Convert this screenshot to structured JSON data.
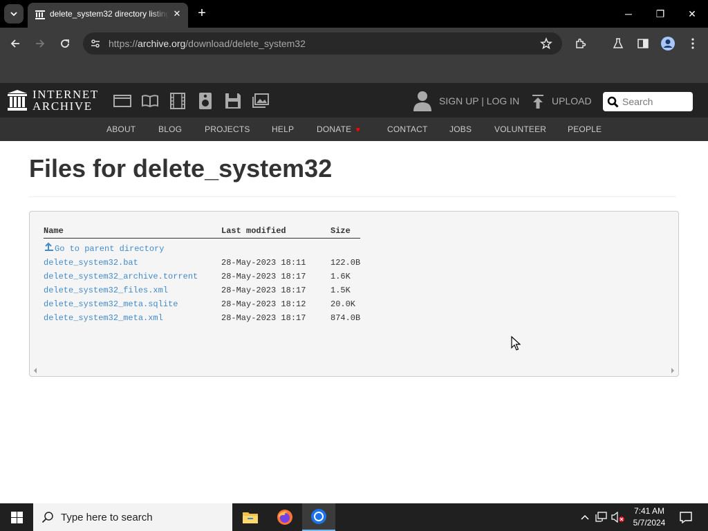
{
  "browser": {
    "tab_title": "delete_system32 directory listing",
    "url_scheme": "https://",
    "url_host": "archive.org",
    "url_path": "/download/delete_system32",
    "window_controls": {
      "minimize": "─",
      "restore": "❐",
      "close": "✕"
    }
  },
  "ia": {
    "logo_line1": "INTERNET",
    "logo_line2": "ARCHIVE",
    "media_icons": [
      "web-icon",
      "texts-icon",
      "video-icon",
      "audio-icon",
      "software-icon",
      "images-icon"
    ],
    "signup": "SIGN UP | LOG IN",
    "upload": "UPLOAD",
    "search_placeholder": "Search",
    "nav": [
      "ABOUT",
      "BLOG",
      "PROJECTS",
      "HELP",
      "DONATE",
      "CONTACT",
      "JOBS",
      "VOLUNTEER",
      "PEOPLE"
    ]
  },
  "page": {
    "title": "Files for delete_system32",
    "columns": [
      "Name",
      "Last modified",
      "Size"
    ],
    "parent_link": "Go to parent directory",
    "files": [
      {
        "name": "delete_system32.bat",
        "modified": "28-May-2023 18:11",
        "size": "122.0B"
      },
      {
        "name": "delete_system32_archive.torrent",
        "modified": "28-May-2023 18:17",
        "size": "1.6K"
      },
      {
        "name": "delete_system32_files.xml",
        "modified": "28-May-2023 18:17",
        "size": "1.5K"
      },
      {
        "name": "delete_system32_meta.sqlite",
        "modified": "28-May-2023 18:12",
        "size": "20.0K"
      },
      {
        "name": "delete_system32_meta.xml",
        "modified": "28-May-2023 18:17",
        "size": "874.0B"
      }
    ]
  },
  "taskbar": {
    "search_placeholder": "Type here to search",
    "time": "7:41 AM",
    "date": "5/7/2024"
  },
  "colors": {
    "link": "#428bca",
    "donate_heart": "#ff0000",
    "nav_bg": "#232323",
    "subnav_bg": "#333333",
    "chrome_bg": "#3c3c3c"
  }
}
